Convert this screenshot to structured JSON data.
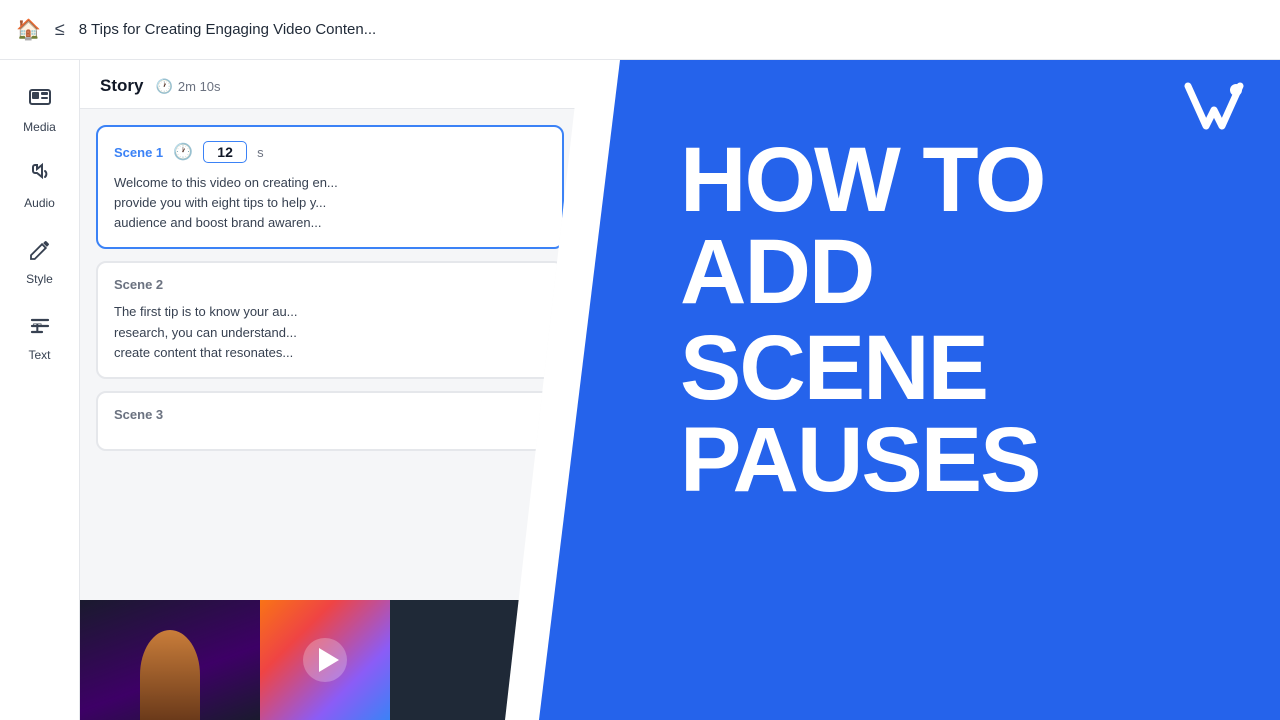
{
  "topbar": {
    "title": "8 Tips for Creating Engaging Video Conten..."
  },
  "sidebar": {
    "items": [
      {
        "id": "media",
        "label": "Media",
        "icon": "media"
      },
      {
        "id": "audio",
        "label": "Audio",
        "icon": "audio"
      },
      {
        "id": "style",
        "label": "Style",
        "icon": "style"
      },
      {
        "id": "text",
        "label": "Text",
        "icon": "text"
      }
    ]
  },
  "story": {
    "title": "Story",
    "duration": "2m 10s",
    "scenes": [
      {
        "id": "scene1",
        "label": "Scene 1",
        "duration_value": "12",
        "duration_unit": "s",
        "text": "Welcome to this video on creating en... provide you with eight tips to help y... audience and boost brand awaren...",
        "active": true
      },
      {
        "id": "scene2",
        "label": "Scene 2",
        "text": "The first tip is to know your au... research, you can understand... create content that resonates...",
        "active": false
      },
      {
        "id": "scene3",
        "label": "Scene 3",
        "text": "",
        "active": false
      }
    ]
  },
  "blue_panel": {
    "line1": "HOW TO ADD",
    "line2": "SCENE PAUSES"
  },
  "logo": {
    "alt": "Visla logo"
  }
}
